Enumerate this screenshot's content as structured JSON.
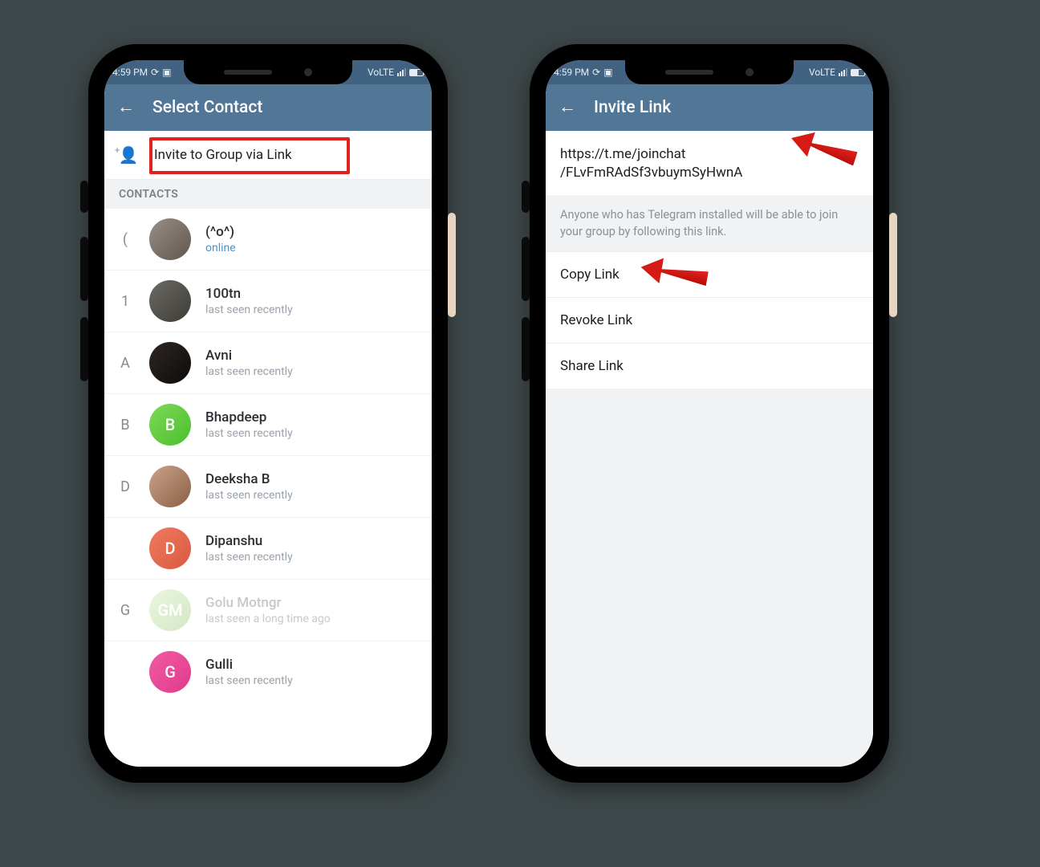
{
  "status": {
    "time": "4:59 PM",
    "net_label": "VoLTE"
  },
  "left_screen": {
    "title": "Select Contact",
    "invite_label": "Invite to Group via Link",
    "contacts_header": "CONTACTS",
    "status_online": "online",
    "status_recent": "last seen recently",
    "status_long": "last seen a long time ago",
    "rows": [
      {
        "indexer": "(",
        "name": "(^o^)"
      },
      {
        "indexer": "1",
        "name": "100tn"
      },
      {
        "indexer": "A",
        "name": "Avni"
      },
      {
        "indexer": "B",
        "name": "Bhapdeep",
        "initial": "B"
      },
      {
        "indexer": "D",
        "name": "Deeksha B"
      },
      {
        "indexer": "",
        "name": "Dipanshu",
        "initial": "D"
      },
      {
        "indexer": "G",
        "name": "Golu Motngr",
        "initial": "GM"
      },
      {
        "indexer": "",
        "name": "Gulli",
        "initial": "G"
      }
    ]
  },
  "right_screen": {
    "title": "Invite Link",
    "link_line1": "https://t.me/joinchat",
    "link_line2": "/FLvFmRAdSf3vbuymSyHwnA",
    "hint": "Anyone who has Telegram installed will be able to join your group by following this link.",
    "actions": {
      "copy": "Copy Link",
      "revoke": "Revoke Link",
      "share": "Share Link"
    }
  }
}
